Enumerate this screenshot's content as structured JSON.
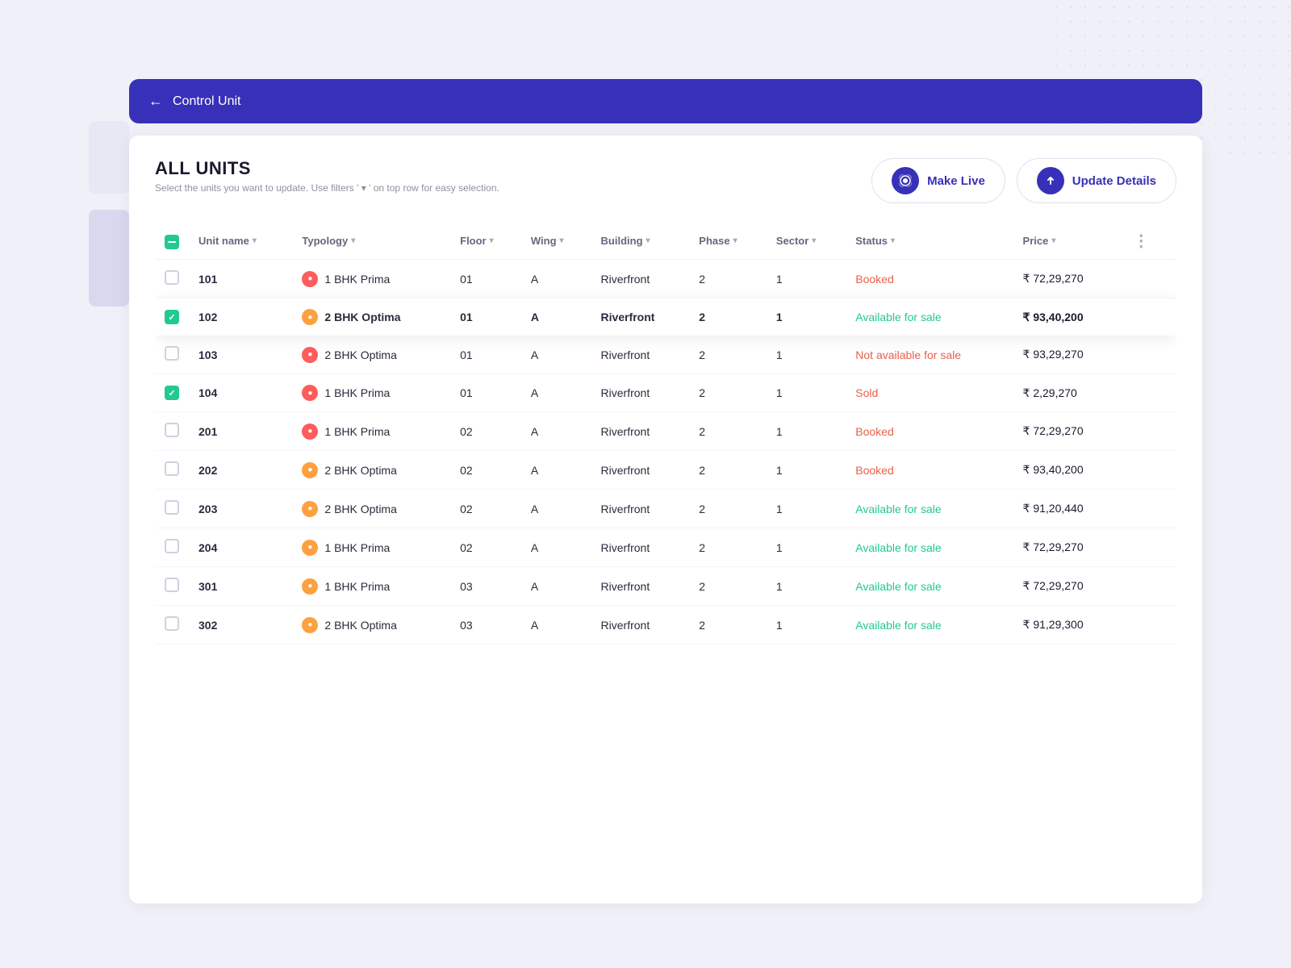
{
  "topbar": {
    "title": "Control Unit",
    "back_label": "←"
  },
  "page": {
    "title": "ALL UNITS",
    "subtitle": "Select the units you want to update. Use filters ' ▾ ' on top row for easy selection.",
    "make_live_label": "Make Live",
    "update_details_label": "Update Details"
  },
  "table": {
    "columns": [
      {
        "key": "checkbox",
        "label": ""
      },
      {
        "key": "unit_name",
        "label": "Unit name"
      },
      {
        "key": "typology",
        "label": "Typology"
      },
      {
        "key": "floor",
        "label": "Floor"
      },
      {
        "key": "wing",
        "label": "Wing"
      },
      {
        "key": "building",
        "label": "Building"
      },
      {
        "key": "phase",
        "label": "Phase"
      },
      {
        "key": "sector",
        "label": "Sector"
      },
      {
        "key": "status",
        "label": "Status"
      },
      {
        "key": "price",
        "label": "Price"
      },
      {
        "key": "more",
        "label": ""
      }
    ],
    "rows": [
      {
        "id": "101",
        "unit": "101",
        "typology": "1 BHK Prima",
        "typo_color": "red",
        "floor": "01",
        "wing": "A",
        "building": "Riverfront",
        "phase": "2",
        "sector": "1",
        "status": "Booked",
        "status_class": "booked",
        "price": "₹ 72,29,270",
        "checked": false,
        "selected": false
      },
      {
        "id": "102",
        "unit": "102",
        "typology": "2 BHK Optima",
        "typo_color": "orange",
        "floor": "01",
        "wing": "A",
        "building": "Riverfront",
        "phase": "2",
        "sector": "1",
        "status": "Available for sale",
        "status_class": "available",
        "price": "₹ 93,40,200",
        "checked": true,
        "selected": true
      },
      {
        "id": "103",
        "unit": "103",
        "typology": "2 BHK Optima",
        "typo_color": "red",
        "floor": "01",
        "wing": "A",
        "building": "Riverfront",
        "phase": "2",
        "sector": "1",
        "status": "Not available for sale",
        "status_class": "not-available",
        "price": "₹ 93,29,270",
        "checked": false,
        "selected": false
      },
      {
        "id": "104",
        "unit": "104",
        "typology": "1 BHK Prima",
        "typo_color": "red",
        "floor": "01",
        "wing": "A",
        "building": "Riverfront",
        "phase": "2",
        "sector": "1",
        "status": "Sold",
        "status_class": "sold",
        "price": "₹ 2,29,270",
        "checked": true,
        "selected": false
      },
      {
        "id": "201",
        "unit": "201",
        "typology": "1 BHK Prima",
        "typo_color": "red",
        "floor": "02",
        "wing": "A",
        "building": "Riverfront",
        "phase": "2",
        "sector": "1",
        "status": "Booked",
        "status_class": "booked",
        "price": "₹ 72,29,270",
        "checked": false,
        "selected": false
      },
      {
        "id": "202",
        "unit": "202",
        "typology": "2 BHK Optima",
        "typo_color": "orange",
        "floor": "02",
        "wing": "A",
        "building": "Riverfront",
        "phase": "2",
        "sector": "1",
        "status": "Booked",
        "status_class": "booked",
        "price": "₹ 93,40,200",
        "checked": false,
        "selected": false
      },
      {
        "id": "203",
        "unit": "203",
        "typology": "2 BHK Optima",
        "typo_color": "orange",
        "floor": "02",
        "wing": "A",
        "building": "Riverfront",
        "phase": "2",
        "sector": "1",
        "status": "Available for sale",
        "status_class": "available",
        "price": "₹ 91,20,440",
        "checked": false,
        "selected": false
      },
      {
        "id": "204",
        "unit": "204",
        "typology": "1 BHK Prima",
        "typo_color": "orange",
        "floor": "02",
        "wing": "A",
        "building": "Riverfront",
        "phase": "2",
        "sector": "1",
        "status": "Available for sale",
        "status_class": "available",
        "price": "₹ 72,29,270",
        "checked": false,
        "selected": false
      },
      {
        "id": "301",
        "unit": "301",
        "typology": "1 BHK Prima",
        "typo_color": "orange",
        "floor": "03",
        "wing": "A",
        "building": "Riverfront",
        "phase": "2",
        "sector": "1",
        "status": "Available for sale",
        "status_class": "available",
        "price": "₹ 72,29,270",
        "checked": false,
        "selected": false
      },
      {
        "id": "302",
        "unit": "302",
        "typology": "2 BHK Optima",
        "typo_color": "orange",
        "floor": "03",
        "wing": "A",
        "building": "Riverfront",
        "phase": "2",
        "sector": "1",
        "status": "Available for sale",
        "status_class": "available",
        "price": "₹ 91,29,300",
        "checked": false,
        "selected": false
      }
    ]
  }
}
